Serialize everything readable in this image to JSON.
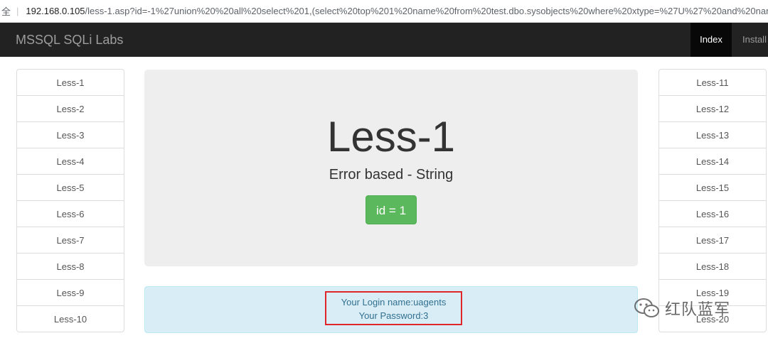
{
  "address_bar": {
    "security_label": "全",
    "url_host": "192.168.0.105",
    "url_path": "/less-1.asp?id=-1%27union%20%20all%20select%201,(select%20top%201%20name%20from%20test.dbo.sysobjects%20where%20xtype=%27U%27%20and%20name%2..."
  },
  "navbar": {
    "brand": "MSSQL SQLi Labs",
    "links": [
      {
        "label": "Index",
        "active": true
      },
      {
        "label": "Install",
        "active": false
      }
    ]
  },
  "left_list": [
    "Less-1",
    "Less-2",
    "Less-3",
    "Less-4",
    "Less-5",
    "Less-6",
    "Less-7",
    "Less-8",
    "Less-9",
    "Less-10"
  ],
  "right_list": [
    "Less-11",
    "Less-12",
    "Less-13",
    "Less-14",
    "Less-15",
    "Less-16",
    "Less-17",
    "Less-18",
    "Less-19",
    "Less-20"
  ],
  "jumbotron": {
    "title": "Less-1",
    "subtitle": "Error based - String",
    "button_label": "id = 1",
    "button_color": "#5cb85c"
  },
  "result": {
    "login_line": "Your Login name:uagents",
    "password_line": "Your Password:3",
    "highlight_color": "#e0262b"
  },
  "watermark": {
    "text": "红队蓝军",
    "icon": "wechat-icon"
  }
}
